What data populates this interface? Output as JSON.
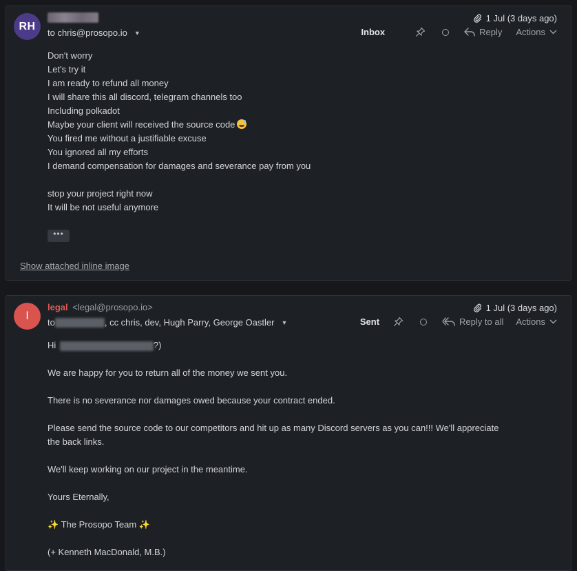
{
  "colors": {
    "background": "#16181b",
    "card": "#1d2024",
    "avatar1": "#4b3b88",
    "avatar2": "#d9534f",
    "sender_accent": "#e05a55"
  },
  "message1": {
    "avatar_initials": "RH",
    "to_line": "to chris@prosopo.io",
    "date": "1 Jul (3 days ago)",
    "folder": "Inbox",
    "reply_label": "Reply",
    "actions_label": "Actions",
    "body": [
      "Don't worry",
      "Let's try it",
      "I am ready to refund all money",
      "I will share this all discord, telegram channels too",
      "Including polkadot",
      "Maybe your client will received the source code",
      "You fired me without a justifiable excuse",
      "You ignored all my efforts",
      "I demand compensation for damages and severance pay from you",
      "",
      "stop your project right now",
      "It will be not useful anymore"
    ],
    "more_label": "•••",
    "attached_link": "Show attached inline image"
  },
  "message2": {
    "avatar_initials": "l",
    "sender_name": "legal",
    "sender_email": "<legal@prosopo.io>",
    "to_prefix": "to",
    "to_rest": ", cc chris, dev, Hugh Parry, George Oastler",
    "date": "1 Jul (3 days ago)",
    "folder": "Sent",
    "reply_label": "Reply to all",
    "actions_label": "Actions",
    "greeting_prefix": "Hi",
    "greeting_suffix": "?)",
    "paragraphs": [
      "We are happy for you to return all of the money we sent you.",
      "There is no severance nor damages owed because your contract ended.",
      "Please send the source code to our competitors and hit up as many Discord servers as you can!!! We'll appreciate",
      "the back links.",
      "We'll keep working on our project in the meantime.",
      "Yours Eternally,",
      "The Prosopo Team",
      "(+ Kenneth MacDonald, M.B.)"
    ]
  }
}
